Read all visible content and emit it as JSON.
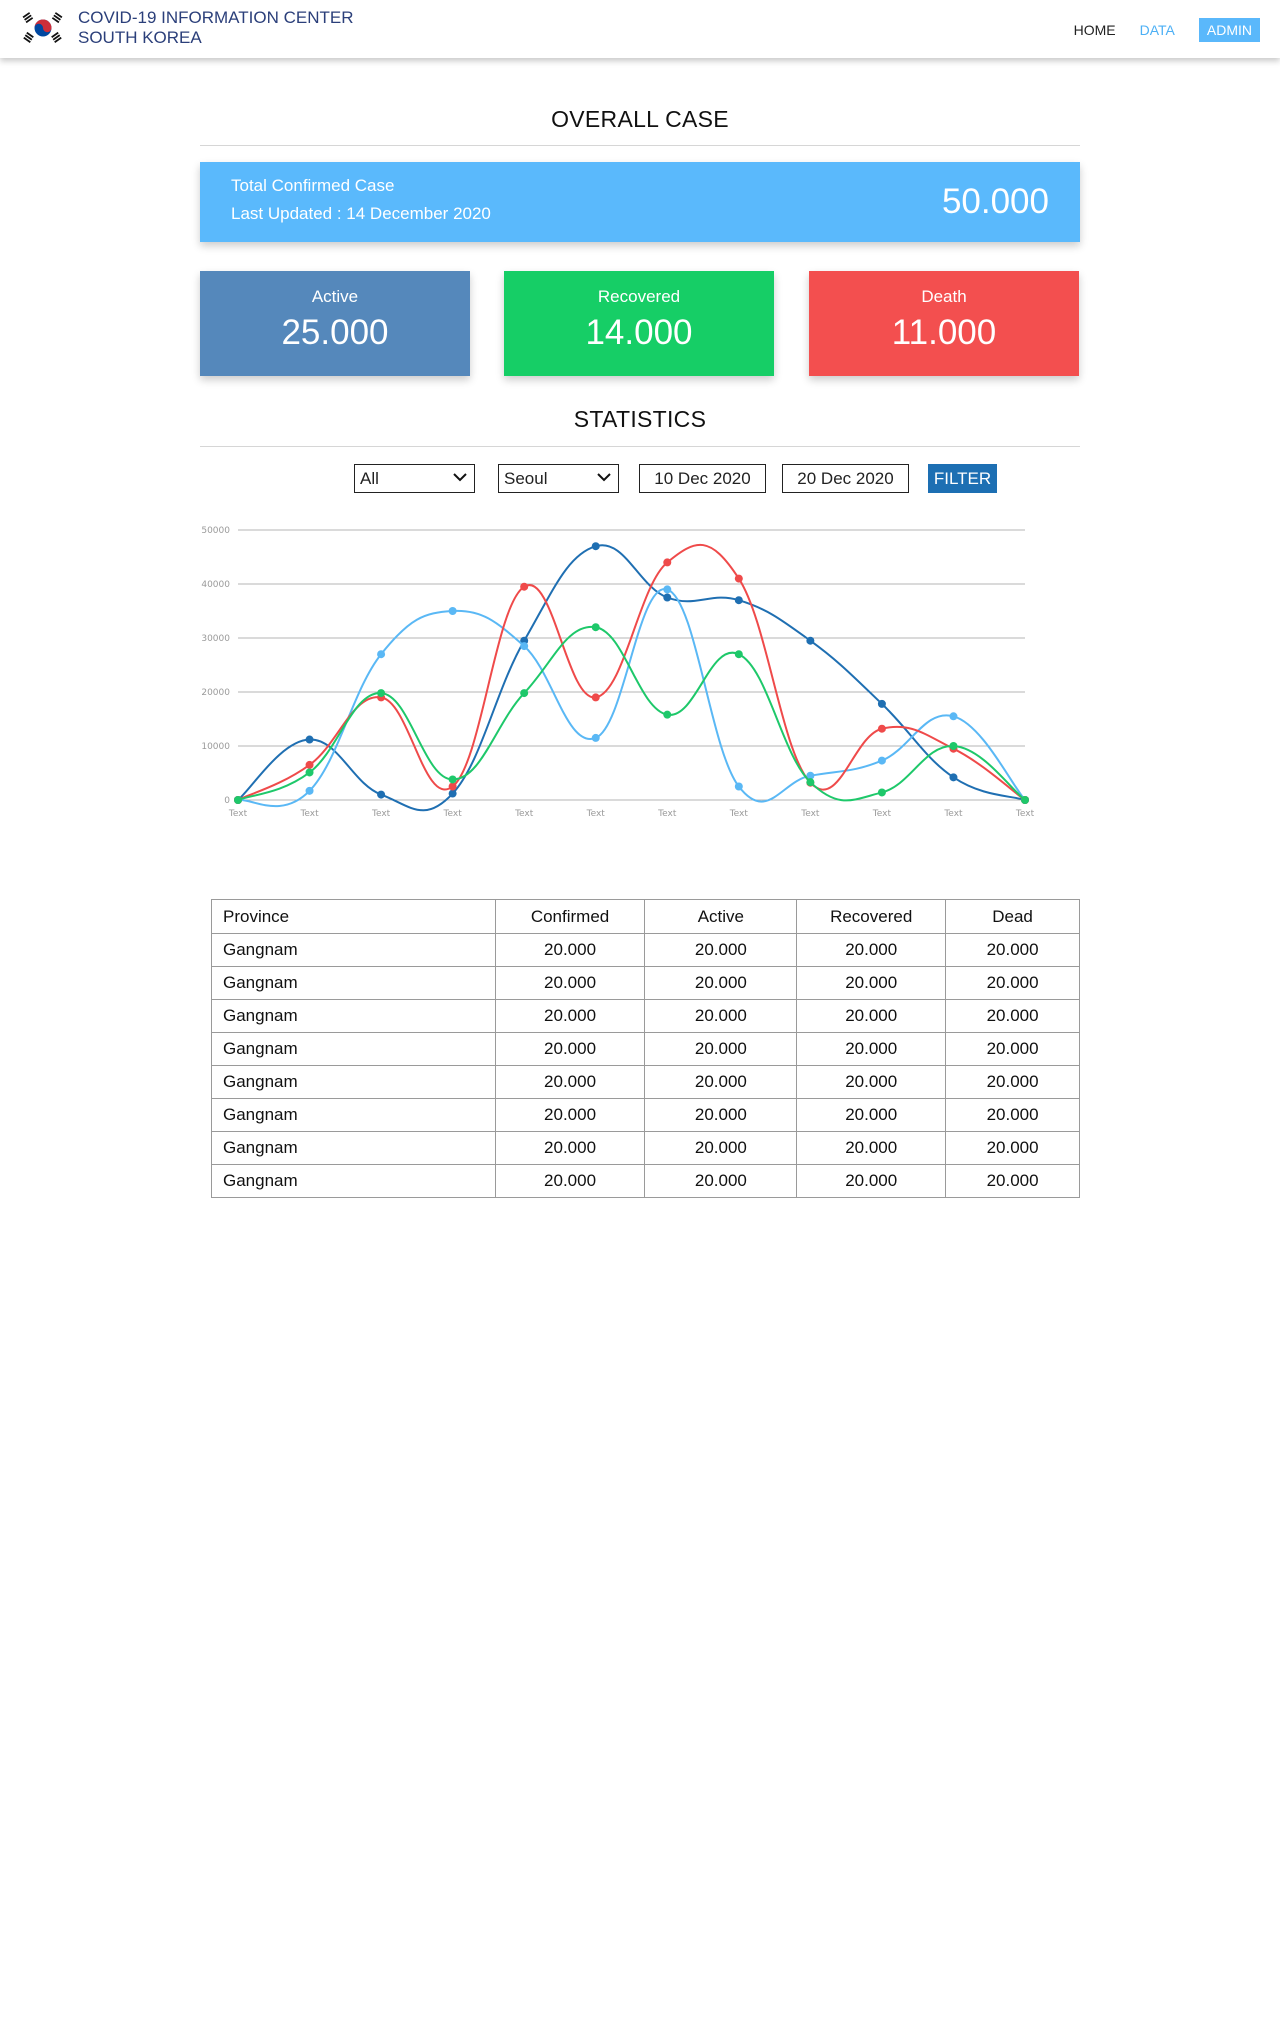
{
  "header": {
    "brand_line1": "COVID-19 INFORMATION CENTER",
    "brand_line2": "SOUTH KOREA",
    "nav": {
      "home": "HOME",
      "data": "DATA",
      "admin": "ADMIN"
    }
  },
  "overall": {
    "title": "OVERALL CASE",
    "total_label": "Total Confirmed Case",
    "last_updated": "Last Updated : 14 December 2020",
    "total_value": "50.000",
    "active_label": "Active",
    "active_value": "25.000",
    "recovered_label": "Recovered",
    "recovered_value": "14.000",
    "death_label": "Death",
    "death_value": "11.000"
  },
  "statistics": {
    "title": "STATISTICS",
    "filters": {
      "category": "All",
      "city": "Seoul",
      "date_from": "10 Dec 2020",
      "date_to": "20 Dec 2020",
      "button": "FILTER"
    }
  },
  "colors": {
    "brand_text": "#2b3f7a",
    "accent_blue": "#5ab9fc",
    "active": "#5588bb",
    "recovered": "#16ce66",
    "death": "#f34f4f",
    "filter_button": "#1d6fb3"
  },
  "chart_data": {
    "type": "line",
    "categories": [
      "Text",
      "Text",
      "Text",
      "Text",
      "Text",
      "Text",
      "Text",
      "Text",
      "Text",
      "Text",
      "Text",
      "Text"
    ],
    "ylim": [
      0,
      50000
    ],
    "yticks": [
      "0",
      "10000",
      "20000",
      "30000",
      "40000",
      "50000"
    ],
    "grid": true,
    "smooth": true,
    "series": [
      {
        "color": "#1f6fb2",
        "values": [
          0,
          11200,
          1000,
          1200,
          29500,
          47000,
          37500,
          37000,
          29500,
          17800,
          4200,
          0
        ]
      },
      {
        "color": "#5ab8f5",
        "values": [
          0,
          1700,
          27000,
          35000,
          28500,
          11500,
          39000,
          2500,
          4500,
          7300,
          15500,
          0
        ]
      },
      {
        "color": "#ef4a4a",
        "values": [
          0,
          6500,
          19000,
          2500,
          39500,
          19000,
          44000,
          41000,
          3200,
          13200,
          9500,
          0
        ]
      },
      {
        "color": "#1ec86a",
        "values": [
          0,
          5100,
          19800,
          3800,
          19800,
          32000,
          15800,
          27000,
          3300,
          1400,
          10000,
          0
        ]
      }
    ]
  },
  "table": {
    "headers": [
      "Province",
      "Confirmed",
      "Active",
      "Recovered",
      "Dead"
    ],
    "rows": [
      [
        "Gangnam",
        "20.000",
        "20.000",
        "20.000",
        "20.000"
      ],
      [
        "Gangnam",
        "20.000",
        "20.000",
        "20.000",
        "20.000"
      ],
      [
        "Gangnam",
        "20.000",
        "20.000",
        "20.000",
        "20.000"
      ],
      [
        "Gangnam",
        "20.000",
        "20.000",
        "20.000",
        "20.000"
      ],
      [
        "Gangnam",
        "20.000",
        "20.000",
        "20.000",
        "20.000"
      ],
      [
        "Gangnam",
        "20.000",
        "20.000",
        "20.000",
        "20.000"
      ],
      [
        "Gangnam",
        "20.000",
        "20.000",
        "20.000",
        "20.000"
      ],
      [
        "Gangnam",
        "20.000",
        "20.000",
        "20.000",
        "20.000"
      ]
    ]
  }
}
